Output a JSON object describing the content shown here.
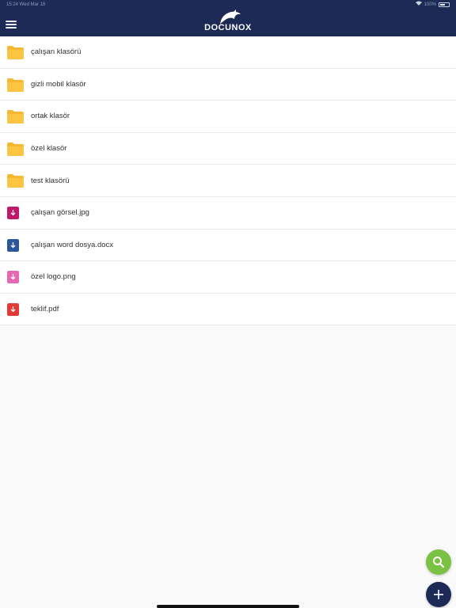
{
  "status_bar": {
    "time_date": "15:24  Wed Mar 18",
    "battery": "100%"
  },
  "header": {
    "menu_icon": "hamburger-icon",
    "logo_text": "DOCUNOX",
    "logo_icon": "dolphin-icon"
  },
  "items": [
    {
      "name": "çalışan klasörü",
      "type": "folder",
      "color": "#f7b730"
    },
    {
      "name": "gizli mobil klasör",
      "type": "folder",
      "color": "#f7b730"
    },
    {
      "name": "ortak klasör",
      "type": "folder",
      "color": "#f7b730"
    },
    {
      "name": "özel klasör",
      "type": "folder",
      "color": "#f7b730"
    },
    {
      "name": "test klasörü",
      "type": "folder",
      "color": "#f7b730"
    },
    {
      "name": "çalışan görsel.jpg",
      "type": "file",
      "color": "#c2186b"
    },
    {
      "name": "çalışan word dosya.docx",
      "type": "file",
      "color": "#2b579a"
    },
    {
      "name": "özel logo.png",
      "type": "file",
      "color": "#e668b3"
    },
    {
      "name": "teklif.pdf",
      "type": "file",
      "color": "#e53935"
    }
  ],
  "fab": {
    "search_icon": "search-icon",
    "add_icon": "plus-icon",
    "search_color": "#7cc242",
    "add_color": "#1c2a55"
  },
  "colors": {
    "navbar": "#1c2a55"
  }
}
